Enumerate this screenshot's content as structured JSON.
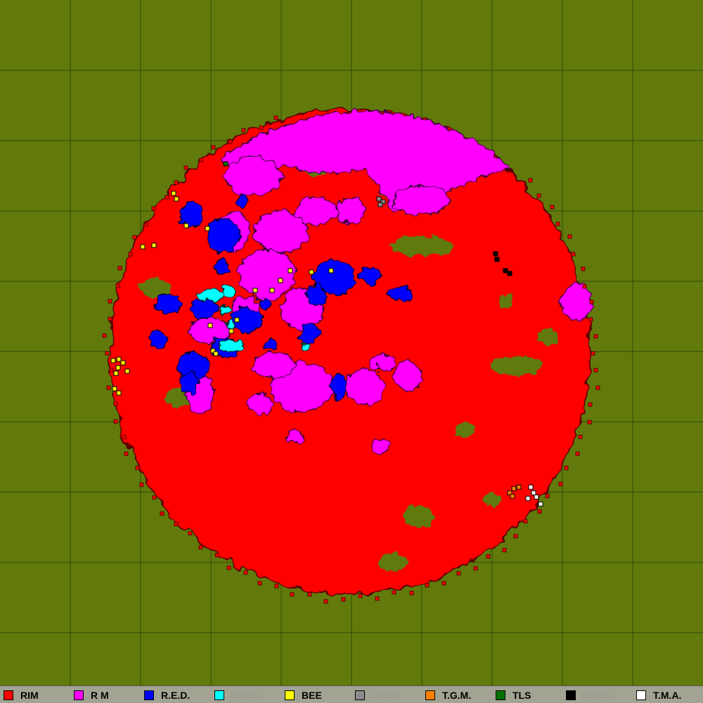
{
  "map": {
    "colors": {
      "background": "#617a0b",
      "grid": "#2f4a08",
      "territory": "#ff0000",
      "cell_border": "#5a0000"
    }
  },
  "legend": {
    "items": [
      {
        "label": "RIM",
        "color": "#ff0000",
        "faded": false
      },
      {
        "label": "R  M",
        "color": "#ff00ff",
        "faded": false
      },
      {
        "label": "R.E.D.",
        "color": "#0000ff",
        "faded": false
      },
      {
        "label": "□□□□□",
        "color": "#00ffff",
        "faded": true
      },
      {
        "label": "BEE",
        "color": "#ffff00",
        "faded": false
      },
      {
        "label": "□□□□□",
        "color": "#8c8c8c",
        "faded": true
      },
      {
        "label": "T.G.M.",
        "color": "#ff8000",
        "faded": false
      },
      {
        "label": "TLS",
        "color": "#007000",
        "faded": false
      },
      {
        "label": "□□□□□",
        "color": "#000000",
        "faded": true
      },
      {
        "label": "T.M.A.",
        "color": "#ffffff",
        "faded": false
      }
    ]
  }
}
